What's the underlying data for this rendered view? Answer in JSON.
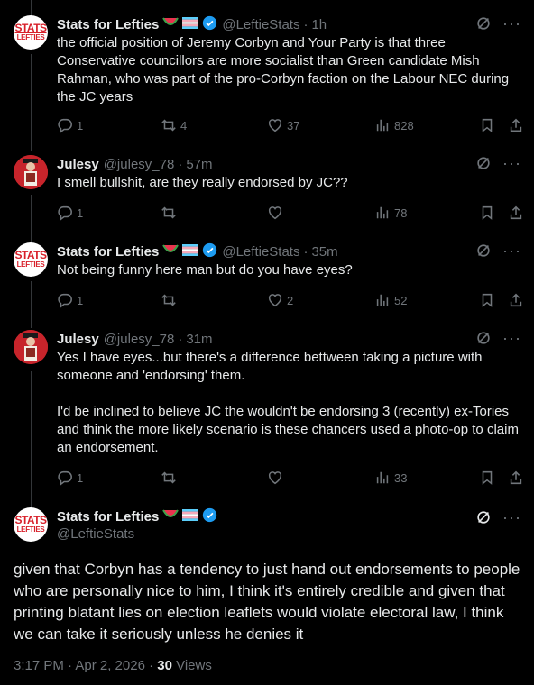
{
  "tweets": [
    {
      "name": "Stats for Lefties",
      "handle": "@LeftieStats",
      "time": "1h",
      "text": "the official position of Jeremy Corbyn and Your Party is that three Conservative councillors are more socialist than Green candidate Mish Rahman, who was part of the pro-Corbyn faction on the Labour NEC during the JC years",
      "replies": "1",
      "retweets": "4",
      "likes": "37",
      "views": "828"
    },
    {
      "name": "Julesy",
      "handle": "@julesy_78",
      "time": "57m",
      "text": "I smell bullshit, are they really endorsed by JC??",
      "replies": "1",
      "retweets": "",
      "likes": "",
      "views": "78"
    },
    {
      "name": "Stats for Lefties",
      "handle": "@LeftieStats",
      "time": "35m",
      "text": "Not being funny here man but do you have eyes?",
      "replies": "1",
      "retweets": "",
      "likes": "2",
      "views": "52"
    },
    {
      "name": "Julesy",
      "handle": "@julesy_78",
      "time": "31m",
      "text": "Yes I have eyes...but there's a difference bettween taking a picture with someone and 'endorsing' them.\n\nI'd be inclined to believe JC the wouldn't be endorsing 3 (recently) ex-Tories and think the more likely scenario is these chancers used a photo-op to claim an endorsement.",
      "replies": "1",
      "retweets": "",
      "likes": "",
      "views": "33"
    }
  ],
  "main": {
    "name": "Stats for Lefties",
    "handle": "@LeftieStats",
    "text": "given that Corbyn has a tendency to just hand out endorsements to people who are personally nice to him, I think it's entirely credible and given that printing blatant lies on election leaflets would violate electoral law, I think we can take it seriously unless he denies it",
    "timestamp": "3:17 PM · Apr 2, 2026 · ",
    "views_count": "30",
    "views_label": " Views"
  },
  "avatar": {
    "stats_line1": "STATS",
    "stats_line2": "LEFTIES"
  },
  "colors": {
    "verified": "#1d9bf0",
    "muted": "#71767b",
    "brand_red": "#d8202a"
  }
}
